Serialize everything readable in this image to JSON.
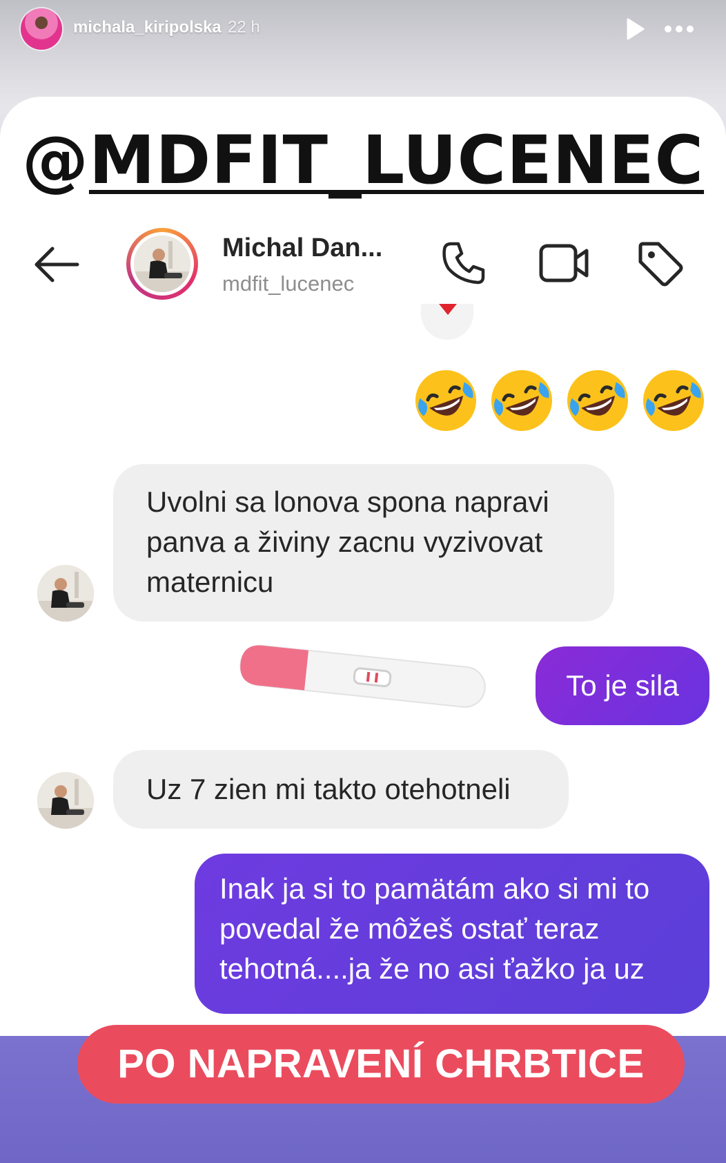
{
  "story": {
    "username": "michala_kiripolska",
    "time": "22 h",
    "icons": {
      "avatar": "profile-avatar",
      "play": "play-icon",
      "more": "more-dots-icon"
    }
  },
  "overlay": {
    "handle_at": "@",
    "handle_name": "MDFIT_LUCENEC",
    "banner": "PO NAPRAVENÍ CHRBTICE",
    "banner_color": "#ea4c5e"
  },
  "chat": {
    "header": {
      "name": "Michal Dan...",
      "username": "mdfit_lucenec",
      "icons": [
        "back-arrow-icon",
        "phone-icon",
        "video-icon",
        "tag-icon"
      ]
    },
    "emojis": [
      "🤣",
      "🤣",
      "🤣",
      "🤣"
    ],
    "messages": [
      {
        "from": "them",
        "text": "Uvolni sa lonova spona napravi panva a živiny zacnu vyzivovat maternicu"
      },
      {
        "from": "me",
        "text": "To je sila"
      },
      {
        "from": "them",
        "text": "Uz 7 zien mi takto otehotneli"
      },
      {
        "from": "me",
        "text": "Inak ja si to pamätám ako si mi to povedal že môžeš ostať teraz tehotná....ja že no asi ťažko ja uz"
      }
    ],
    "colors": {
      "incoming_bg": "#efefef",
      "outgoing_bg": "#6a33e0",
      "accent": "#e1306c"
    }
  }
}
